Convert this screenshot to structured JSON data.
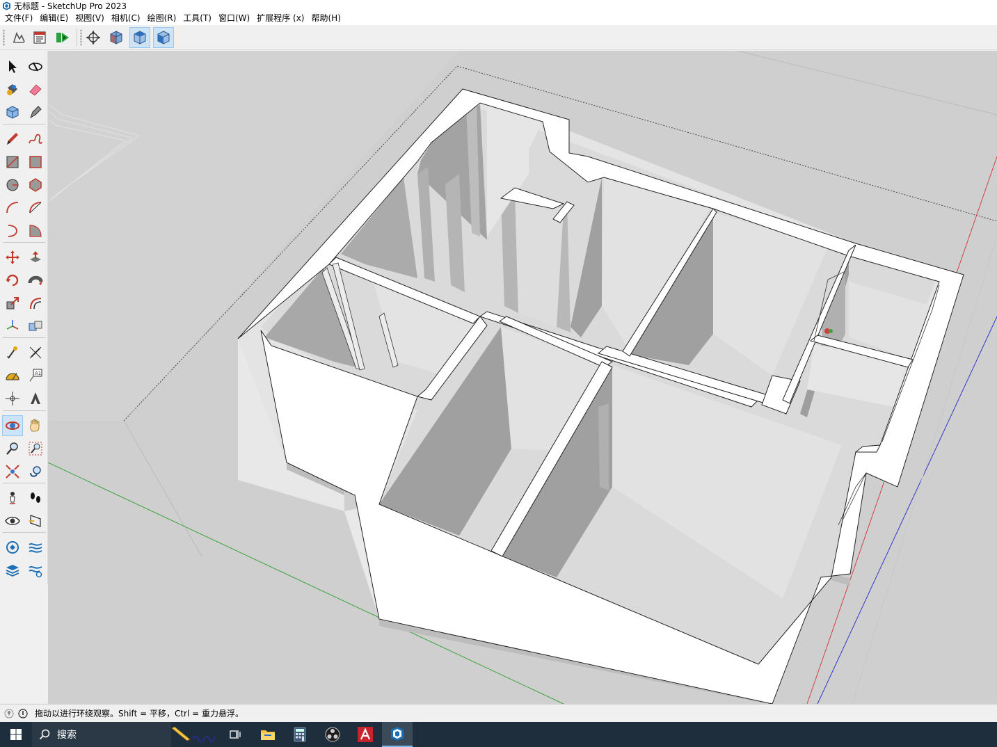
{
  "window": {
    "title": "无标题 - SketchUp Pro 2023"
  },
  "menubar": {
    "items": [
      "文件(F)",
      "编辑(E)",
      "视图(V)",
      "相机(C)",
      "绘图(R)",
      "工具(T)",
      "窗口(W)",
      "扩展程序 (x)",
      "帮助(H)"
    ]
  },
  "toolbar": {
    "buttons": [
      {
        "icon": "3d-warehouse-icon"
      },
      {
        "icon": "model-info-icon"
      },
      {
        "icon": "extension-warehouse-icon"
      },
      {
        "icon": "orbit-position-icon"
      },
      {
        "icon": "iso-view-icon"
      },
      {
        "icon": "top-view-icon"
      },
      {
        "icon": "front-view-icon"
      }
    ]
  },
  "left_toolbar": {
    "tools": [
      "select-icon",
      "orbit-paint-icon",
      "paint-bucket-icon",
      "eraser-icon",
      "component-icon",
      "tag-tool-icon",
      "pencil-line-icon",
      "freehand-icon",
      "rectangle-icon",
      "rotated-rectangle-icon",
      "circle-icon",
      "polygon-icon",
      "arc-icon",
      "two-point-arc-icon",
      "three-point-arc-icon",
      "pie-icon",
      "move-icon",
      "push-pull-icon",
      "rotate-icon",
      "follow-me-icon",
      "scale-icon",
      "offset-icon",
      "axes-icon",
      "solid-tools-icon",
      "tape-measure-icon",
      "dimension-icon",
      "protractor-icon",
      "text-icon",
      "axes-position-icon",
      "3d-text-icon",
      "orbit-icon",
      "pan-icon",
      "zoom-icon",
      "zoom-window-icon",
      "zoom-extents-icon",
      "previous-view-icon",
      "position-camera-icon",
      "walk-icon",
      "look-around-icon",
      "section-plane-icon",
      "sandbox-icon",
      "layers-flow-icon",
      "stack-layers-icon",
      "settings-layers-icon"
    ],
    "active": "orbit-icon"
  },
  "status": {
    "hint": "拖动以进行环绕观察。Shift = 平移，Ctrl = 重力悬浮。"
  },
  "taskbar": {
    "search_label": "搜索"
  },
  "colors": {
    "viewport_bg": "#cfcfcf",
    "wall_top": "#ffffff",
    "wall_side_light": "#e6e6e6",
    "wall_side_dark": "#a6a6a6",
    "floor": "#dcdcdc",
    "axis_red": "#d04040",
    "axis_green": "#3aa23a",
    "axis_blue": "#3535c8",
    "taskbar": "#1f2e3c",
    "active_btn": "#cce4f7"
  }
}
